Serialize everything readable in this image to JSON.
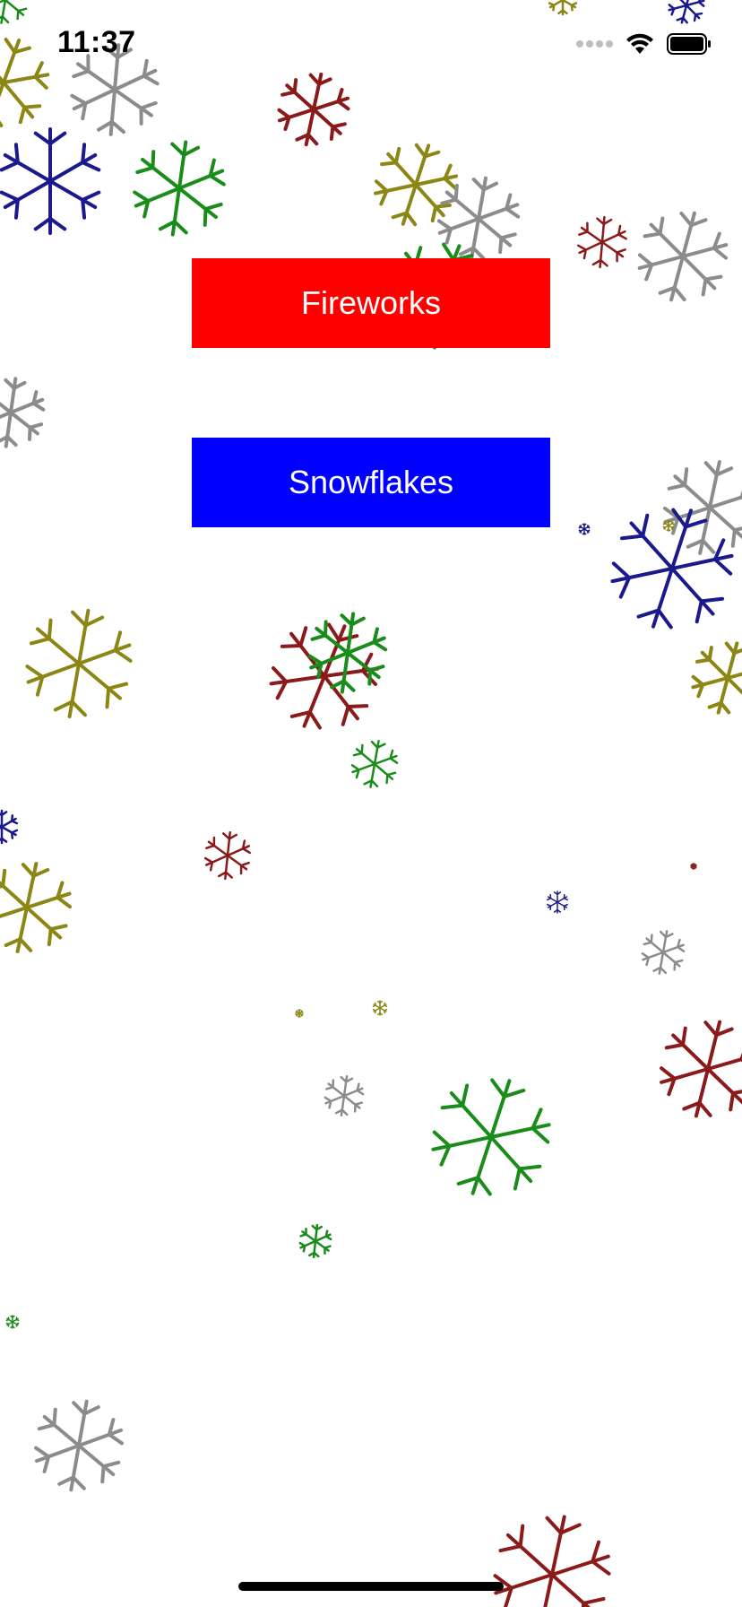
{
  "status_bar": {
    "time": "11:37",
    "icons": [
      "signal-icon",
      "wifi-icon",
      "battery-icon"
    ]
  },
  "buttons": {
    "fireworks": {
      "label": "Fireworks",
      "color": "#ff0000"
    },
    "snowflakes": {
      "label": "Snowflakes",
      "color": "#0000ff"
    }
  },
  "snowflake_colors": {
    "red": "#8b1a1a",
    "green": "#1a8c1a",
    "blue": "#1a1a8c",
    "gray": "#8c8c8c",
    "olive": "#8c8614"
  }
}
